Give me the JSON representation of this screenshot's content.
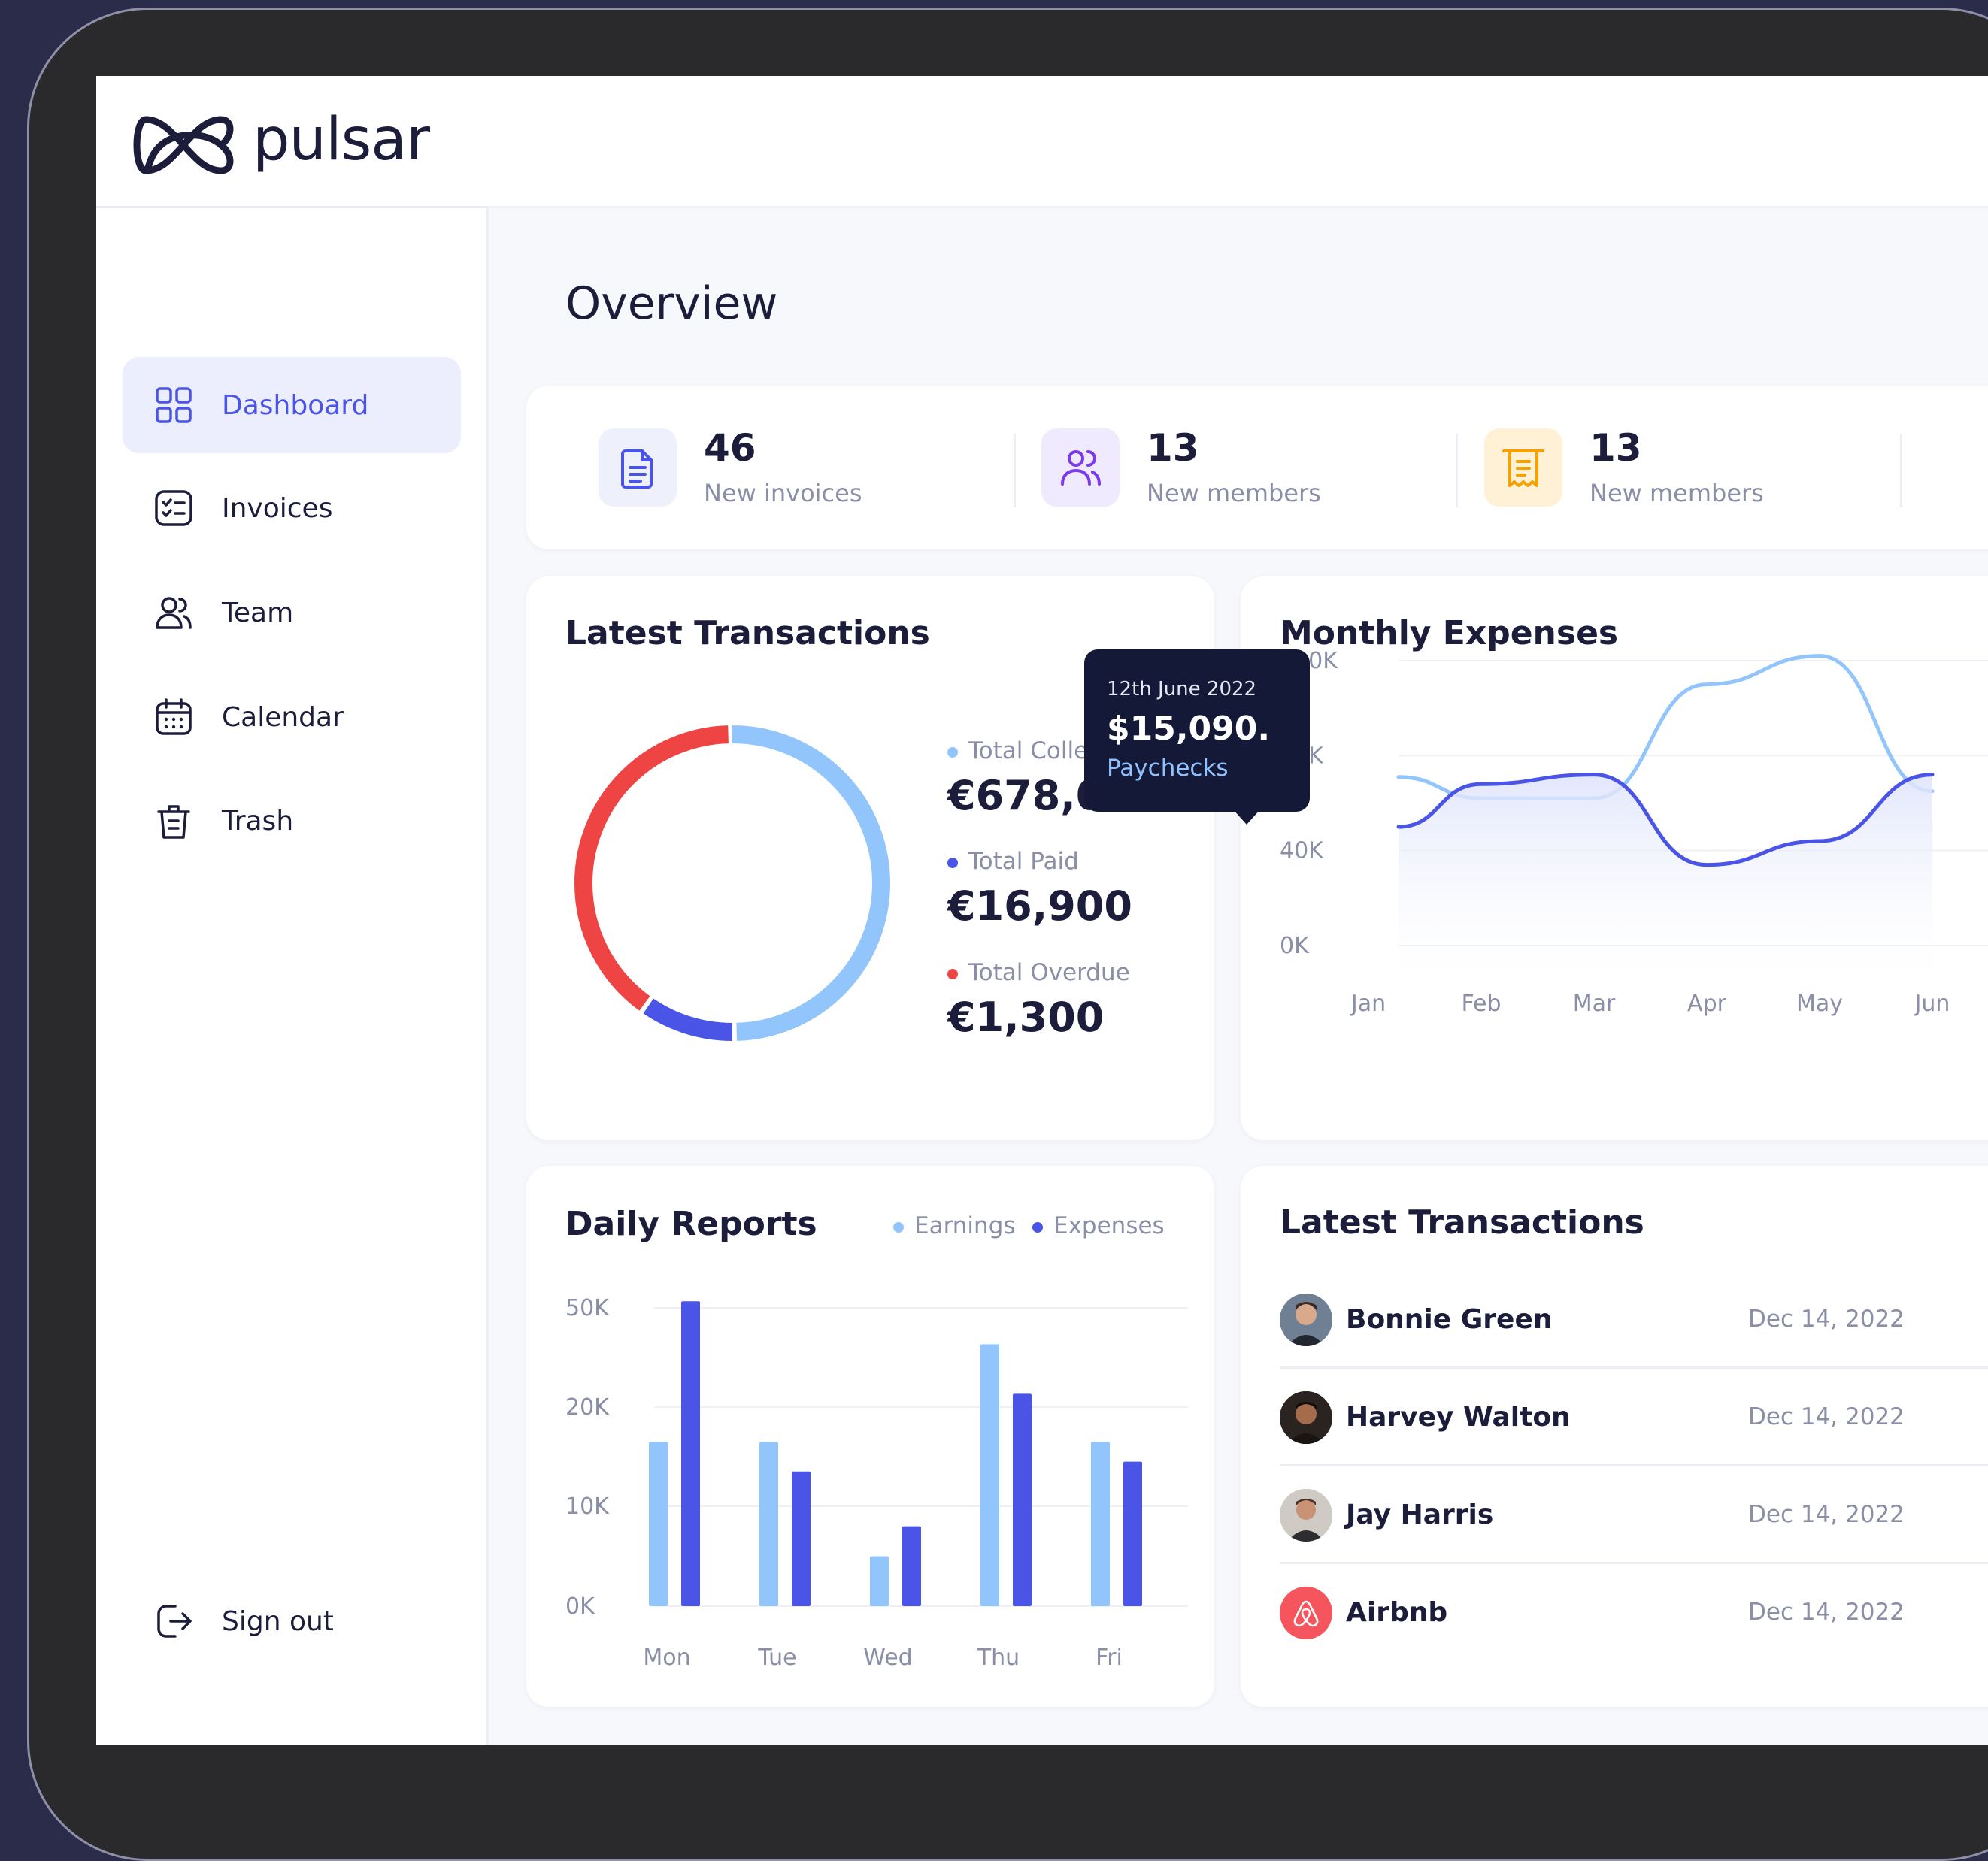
{
  "app": {
    "brand": "pulsar"
  },
  "sidebar": {
    "items": [
      {
        "label": "Dashboard",
        "icon": "grid-icon",
        "active": true
      },
      {
        "label": "Invoices",
        "icon": "checklist-icon",
        "active": false
      },
      {
        "label": "Team",
        "icon": "users-icon",
        "active": false
      },
      {
        "label": "Calendar",
        "icon": "calendar-icon",
        "active": false
      },
      {
        "label": "Trash",
        "icon": "trash-icon",
        "active": false
      }
    ],
    "sign_out": {
      "label": "Sign out",
      "icon": "sign-out-icon"
    }
  },
  "main": {
    "title": "Overview"
  },
  "stats": [
    {
      "value": "46",
      "label": "New invoices",
      "icon": "document-icon",
      "color": "#4a55e8",
      "bg": "#eef1fc"
    },
    {
      "value": "13",
      "label": "New members",
      "icon": "users-icon",
      "color": "#7c3aed",
      "bg": "#efeafd"
    },
    {
      "value": "13",
      "label": "New members",
      "icon": "receipt-icon",
      "color": "#f5a100",
      "bg": "#fff1d6"
    }
  ],
  "latest_transactions_summary": {
    "title": "Latest Transactions",
    "items": [
      {
        "label": "Total Collected",
        "value": "€678,071",
        "color": "#93c5fd"
      },
      {
        "label": "Total Paid",
        "value": "€16,900",
        "color": "#4a55e8"
      },
      {
        "label": "Total Overdue",
        "value": "€1,300",
        "color": "#ef4444"
      }
    ]
  },
  "monthly_expenses": {
    "title": "Monthly Expenses",
    "tooltip": {
      "date": "12th June 2022",
      "value": "$15,090.",
      "category": "Paychecks"
    }
  },
  "daily_reports": {
    "title": "Daily Reports",
    "legend": [
      {
        "label": "Earnings",
        "color": "#93c5fd"
      },
      {
        "label": "Expenses",
        "color": "#4a55e8"
      }
    ]
  },
  "latest_transactions": {
    "title": "Latest Transactions",
    "rows": [
      {
        "name": "Bonnie Green",
        "date": "Dec 14, 2022",
        "avatar": "person-avatar"
      },
      {
        "name": "Harvey Walton",
        "date": "Dec 14, 2022",
        "avatar": "person-avatar"
      },
      {
        "name": "Jay Harris",
        "date": "Dec 14, 2022",
        "avatar": "person-avatar"
      },
      {
        "name": "Airbnb",
        "date": "Dec 14, 2022",
        "avatar": "airbnb-logo"
      }
    ]
  },
  "chart_data": [
    {
      "type": "pie",
      "title": "Latest Transactions",
      "categories": [
        "Total Collected",
        "Total Paid",
        "Total Overdue"
      ],
      "values": [
        50,
        10,
        40
      ],
      "colors": [
        "#93c5fd",
        "#4a55e8",
        "#ef4444"
      ]
    },
    {
      "type": "line",
      "title": "Monthly Expenses",
      "categories": [
        "Jan",
        "Feb",
        "Mar",
        "Apr",
        "May",
        "Jun"
      ],
      "yticks": [
        "120K",
        "80K",
        "40K",
        "0K"
      ],
      "ylim": [
        0,
        120000
      ],
      "series": [
        {
          "values": [
            71000,
            62000,
            62000,
            110000,
            122000,
            65000
          ],
          "color": "#93c5fd"
        },
        {
          "values": [
            50000,
            68000,
            72000,
            34000,
            44000,
            72000
          ],
          "color": "#4a55e8"
        }
      ],
      "grid": true
    },
    {
      "type": "bar",
      "title": "Daily Reports",
      "categories": [
        "Mon",
        "Tue",
        "Wed",
        "Thu",
        "Fri"
      ],
      "yticks": [
        "50K",
        "20K",
        "10K",
        "0K"
      ],
      "series": [
        {
          "name": "Earnings",
          "values": [
            16500,
            16500,
            5000,
            39000,
            16500
          ],
          "color": "#93c5fd"
        },
        {
          "name": "Expenses",
          "values": [
            52000,
            13500,
            8000,
            24000,
            14500
          ],
          "color": "#4a55e8"
        }
      ],
      "grid": true,
      "legend": "top-right"
    }
  ]
}
